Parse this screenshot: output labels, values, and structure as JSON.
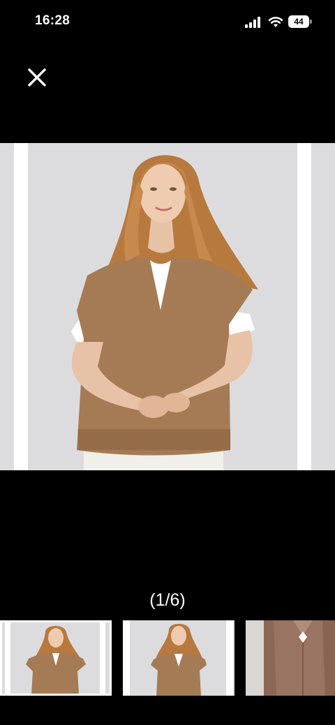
{
  "status_bar": {
    "time": "16:28",
    "battery_level": "44",
    "icons": [
      "signal-icon",
      "wifi-icon",
      "battery-icon"
    ]
  },
  "toolbar": {
    "close_icon": "close-icon"
  },
  "gallery": {
    "counter": "(1/6)",
    "current_index": 1,
    "total": 6,
    "thumbnails_visible": 3,
    "selected_thumbnail": 1
  },
  "colors": {
    "background": "#000000",
    "sweater": "#a47b54",
    "photo_backdrop": "#dcdcde",
    "tshirt": "#ffffff"
  }
}
